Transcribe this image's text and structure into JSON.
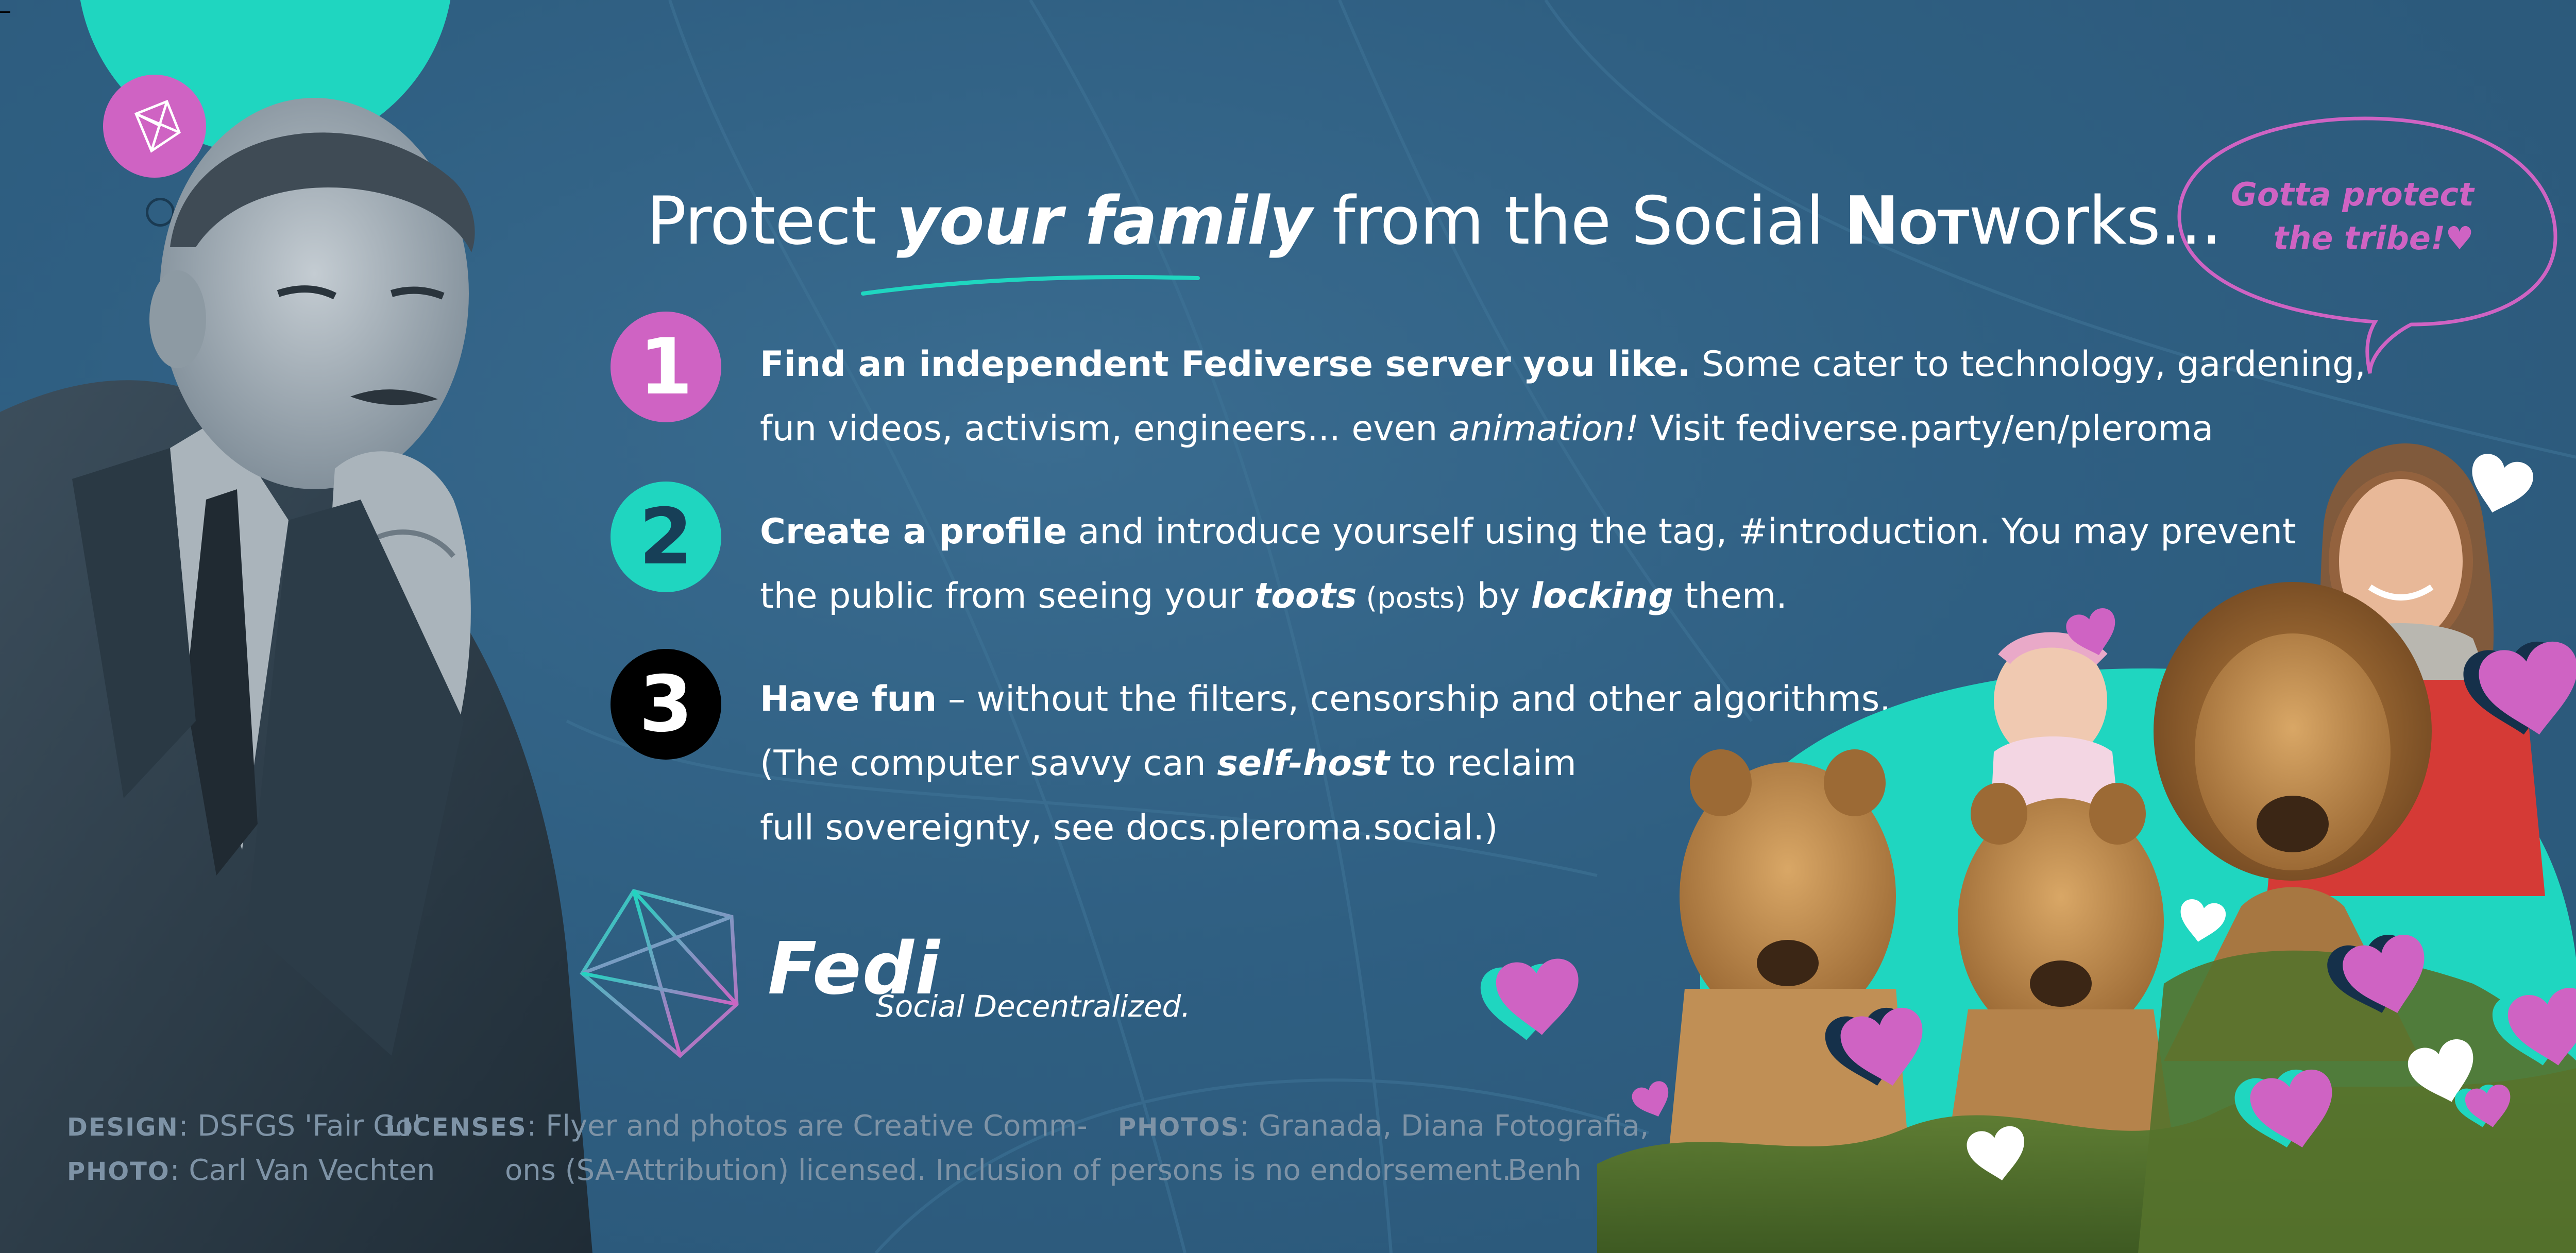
{
  "headline": {
    "part1": "Protect ",
    "emphasis": "your family",
    "part2": " from the Social ",
    "not": "Not",
    "part3": "works..."
  },
  "steps": [
    {
      "number": "1",
      "line1_bold": "Find an independent Fediverse server you like.",
      "line1_rest": "  Some cater to technology, gardening,",
      "line2_a": "fun videos, activism, engineers... even ",
      "line2_italic": "animation!",
      "line2_b": "  Visit fediverse.party/en/pleroma"
    },
    {
      "number": "2",
      "line1_bold": "Create a profile",
      "line1_rest": " and introduce yourself using the tag, #introduction. You may prevent",
      "line2_a": "the public from seeing your ",
      "line2_italic": "toots",
      "line2_small": " (posts)",
      "line2_b": " by ",
      "line2_italic2": "locking",
      "line2_c": " them."
    },
    {
      "number": "3",
      "line1_bold": "Have fun",
      "line1_rest": " – without the filters, censorship and other algorithms.",
      "line2_a": "(The computer savvy can ",
      "line2_italic": "self-host",
      "line2_b": "  to reclaim",
      "line3": "full sovereignty, see docs.pleroma.social.)"
    }
  ],
  "logo": {
    "name": "Fedi",
    "tagline": "Social Decentralized."
  },
  "speech_bubble": {
    "line1": "Gotta protect",
    "line2": "the tribe!♥"
  },
  "credits": {
    "design_label": "DESIGN",
    "design_value": ": DSFGS 'Fair Go'",
    "photo_label": "PHOTO",
    "photo_value": ": Carl Van Vechten",
    "licenses_label": "LICENSES",
    "licenses_line1": ": Flyer and photos are Creative Comm-",
    "licenses_line2": "ons (SA-Attribution) licensed. Inclusion of persons is no endorsement.",
    "photos_label": "PHOTOS",
    "photos_line1": ": Granada, Diana Fotografia,",
    "photos_line2": "Benh"
  },
  "colors": {
    "background": "#2f5f82",
    "teal": "#1fd6c0",
    "pink": "#cf63c3",
    "black": "#000000",
    "white": "#ffffff"
  }
}
